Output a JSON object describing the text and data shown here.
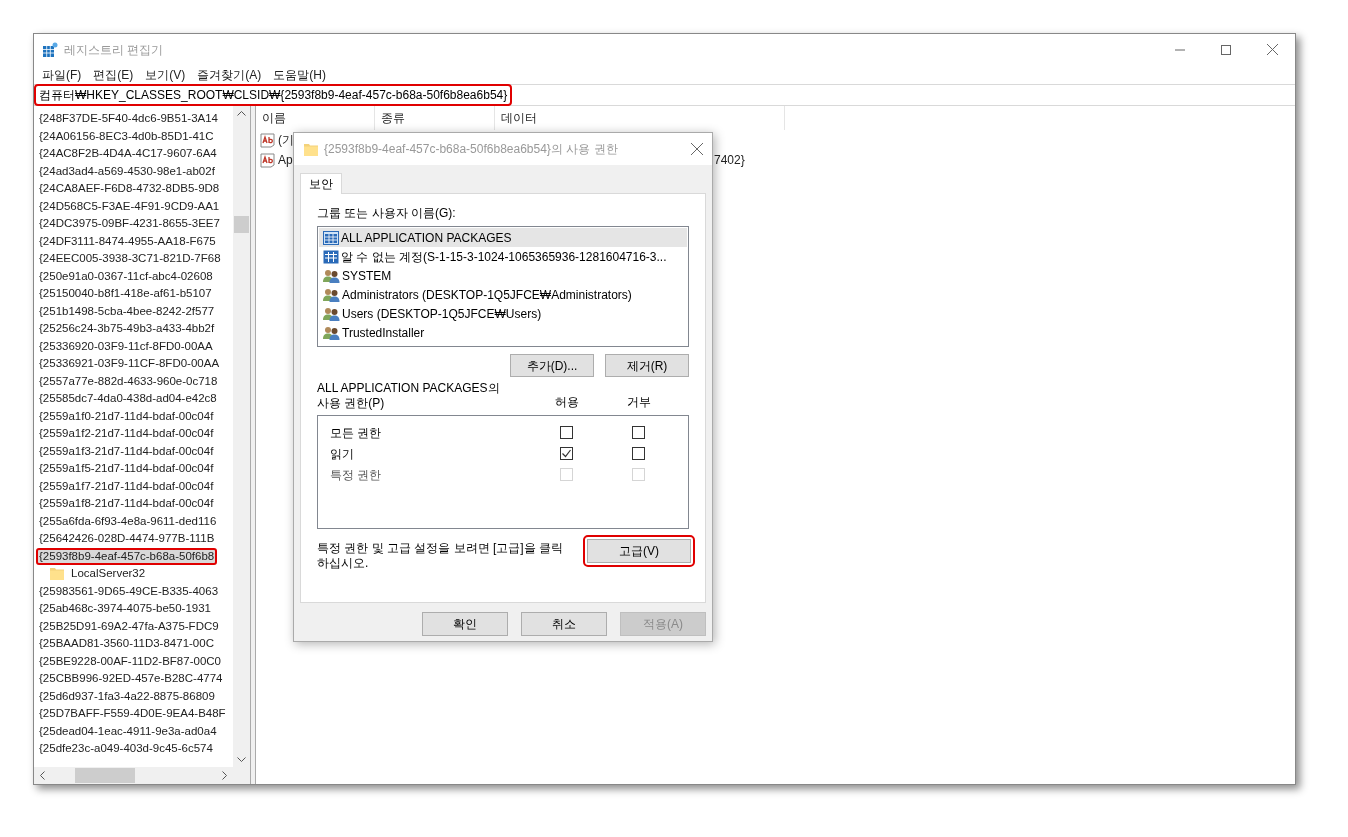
{
  "window": {
    "title": "레지스트리 편집기"
  },
  "menu": [
    "파일(F)",
    "편집(E)",
    "보기(V)",
    "즐겨찾기(A)",
    "도움말(H)"
  ],
  "address_bar": {
    "value": "컴퓨터₩HKEY_CLASSES_ROOT₩CLSID₩{2593f8b9-4eaf-457c-b68a-50f6b8ea6b54}",
    "highlighted": true
  },
  "tree": [
    {
      "label": "{248F37DE-5F40-4dc6-9B51-3A14",
      "selected": false,
      "highlighted": false
    },
    {
      "label": "{24A06156-8EC3-4d0b-85D1-41C",
      "selected": false,
      "highlighted": false
    },
    {
      "label": "{24AC8F2B-4D4A-4C17-9607-6A4",
      "selected": false,
      "highlighted": false
    },
    {
      "label": "{24ad3ad4-a569-4530-98e1-ab02f",
      "selected": false,
      "highlighted": false
    },
    {
      "label": "{24CA8AEF-F6D8-4732-8DB5-9D8",
      "selected": false,
      "highlighted": false
    },
    {
      "label": "{24D568C5-F3AE-4F91-9CD9-AA1",
      "selected": false,
      "highlighted": false
    },
    {
      "label": "{24DC3975-09BF-4231-8655-3EE7",
      "selected": false,
      "highlighted": false
    },
    {
      "label": "{24DF3111-8474-4955-AA18-F675",
      "selected": false,
      "highlighted": false
    },
    {
      "label": "{24EEC005-3938-3C71-821D-7F68",
      "selected": false,
      "highlighted": false
    },
    {
      "label": "{250e91a0-0367-11cf-abc4-02608",
      "selected": false,
      "highlighted": false
    },
    {
      "label": "{25150040-b8f1-418e-af61-b5107",
      "selected": false,
      "highlighted": false
    },
    {
      "label": "{251b1498-5cba-4bee-8242-2f577",
      "selected": false,
      "highlighted": false
    },
    {
      "label": "{25256c24-3b75-49b3-a433-4bb2f",
      "selected": false,
      "highlighted": false
    },
    {
      "label": "{25336920-03F9-11cf-8FD0-00AA",
      "selected": false,
      "highlighted": false
    },
    {
      "label": "{25336921-03F9-11CF-8FD0-00AA",
      "selected": false,
      "highlighted": false
    },
    {
      "label": "{2557a77e-882d-4633-960e-0c718",
      "selected": false,
      "highlighted": false
    },
    {
      "label": "{25585dc7-4da0-438d-ad04-e42c8",
      "selected": false,
      "highlighted": false
    },
    {
      "label": "{2559a1f0-21d7-11d4-bdaf-00c04f",
      "selected": false,
      "highlighted": false
    },
    {
      "label": "{2559a1f2-21d7-11d4-bdaf-00c04f",
      "selected": false,
      "highlighted": false
    },
    {
      "label": "{2559a1f3-21d7-11d4-bdaf-00c04f",
      "selected": false,
      "highlighted": false
    },
    {
      "label": "{2559a1f5-21d7-11d4-bdaf-00c04f",
      "selected": false,
      "highlighted": false
    },
    {
      "label": "{2559a1f7-21d7-11d4-bdaf-00c04f",
      "selected": false,
      "highlighted": false
    },
    {
      "label": "{2559a1f8-21d7-11d4-bdaf-00c04f",
      "selected": false,
      "highlighted": false
    },
    {
      "label": "{255a6fda-6f93-4e8a-9611-ded116",
      "selected": false,
      "highlighted": false
    },
    {
      "label": "{25642426-028D-4474-977B-111B",
      "selected": false,
      "highlighted": false
    },
    {
      "label": "{2593f8b9-4eaf-457c-b68a-50f6b8",
      "selected": true,
      "highlighted": true,
      "children": [
        {
          "label": "LocalServer32",
          "selected": false,
          "highlighted": false
        }
      ]
    },
    {
      "label": "{25983561-9D65-49CE-B335-4063",
      "selected": false,
      "highlighted": false
    },
    {
      "label": "{25ab468c-3974-4075-be50-1931",
      "selected": false,
      "highlighted": false
    },
    {
      "label": "{25B25D91-69A2-47fa-A375-FDC9",
      "selected": false,
      "highlighted": false
    },
    {
      "label": "{25BAAD81-3560-11D3-8471-00C",
      "selected": false,
      "highlighted": false
    },
    {
      "label": "{25BE9228-00AF-11D2-BF87-00C0",
      "selected": false,
      "highlighted": false
    },
    {
      "label": "{25CBB996-92ED-457e-B28C-4774",
      "selected": false,
      "highlighted": false
    },
    {
      "label": "{25d6d937-1fa3-4a22-8875-86809",
      "selected": false,
      "highlighted": false
    },
    {
      "label": "{25D7BAFF-F559-4D0E-9EA4-B48F",
      "selected": false,
      "highlighted": false
    },
    {
      "label": "{25dead04-1eac-4911-9e3a-ad0a4",
      "selected": false,
      "highlighted": false
    },
    {
      "label": "{25dfe23c-a049-403d-9c45-6c574",
      "selected": false,
      "highlighted": false
    }
  ],
  "values": {
    "columns": [
      "이름",
      "종류",
      "데이터"
    ],
    "rows": [
      {
        "name": "(기",
        "data": ""
      },
      {
        "name": "Ap",
        "data": "7402}"
      }
    ]
  },
  "dialog": {
    "title": "{2593f8b9-4eaf-457c-b68a-50f6b8ea6b54}의 사용 권한",
    "tabs": [
      {
        "label": "보안",
        "selected": true
      }
    ],
    "principals_label": "그룹 또는 사용자 이름(G):",
    "principals": [
      {
        "name": "ALL APPLICATION PACKAGES",
        "kind": "package",
        "selected": true
      },
      {
        "name": "알 수 없는 계정(S-1-15-3-1024-1065365936-1281604716-3...",
        "kind": "unknown",
        "selected": false
      },
      {
        "name": "SYSTEM",
        "kind": "group",
        "selected": false
      },
      {
        "name": "Administrators (DESKTOP-1Q5JFCE₩Administrators)",
        "kind": "group",
        "selected": false
      },
      {
        "name": "Users (DESKTOP-1Q5JFCE₩Users)",
        "kind": "group",
        "selected": false
      },
      {
        "name": "TrustedInstaller",
        "kind": "group",
        "selected": false
      }
    ],
    "add_button": "추가(D)...",
    "remove_button": "제거(R)",
    "permissions_label": [
      "ALL APPLICATION PACKAGES의",
      "사용 권한(P)"
    ],
    "allow_header": "허용",
    "deny_header": "거부",
    "permissions": [
      {
        "name": "모든 권한",
        "allow": {
          "checked": false,
          "disabled": false
        },
        "deny": {
          "checked": false,
          "disabled": false
        }
      },
      {
        "name": "읽기",
        "allow": {
          "checked": true,
          "disabled": false
        },
        "deny": {
          "checked": false,
          "disabled": false
        }
      },
      {
        "name": "특정 권한",
        "allow": {
          "checked": false,
          "disabled": true
        },
        "deny": {
          "checked": false,
          "disabled": true
        }
      }
    ],
    "advanced_note": "특정 권한 및 고급 설정을 보려면 [고급]을 클릭 하십시오.",
    "advanced_button": {
      "label": "고급(V)",
      "highlighted": true
    },
    "buttons": [
      {
        "label": "확인",
        "disabled": false
      },
      {
        "label": "취소",
        "disabled": false
      },
      {
        "label": "적용(A)",
        "disabled": true
      }
    ]
  }
}
